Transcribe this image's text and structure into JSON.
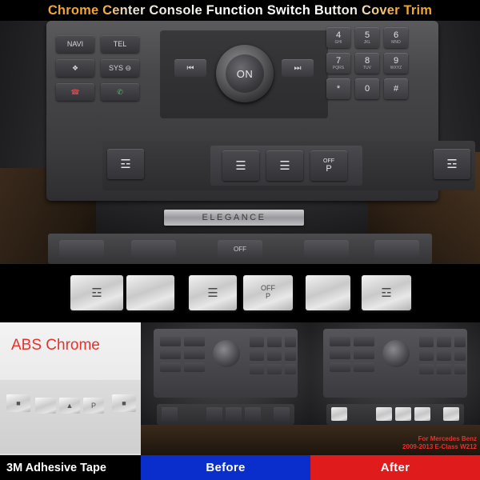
{
  "title": {
    "text": "Chrome Center Console Function Switch Button Cover Trim"
  },
  "main_photo": {
    "name": "mercedes-center-console-photo",
    "head_unit": {
      "knob_label": "ON",
      "prev_label": "⏮",
      "next_label": "⏭"
    },
    "left_keys": [
      {
        "label": "NAVI"
      },
      {
        "label": "TEL"
      },
      {
        "label": "❖"
      },
      {
        "label": "SYS ⊖"
      },
      {
        "label": "☎"
      },
      {
        "label": "✆"
      }
    ],
    "numpad": [
      {
        "n": "4",
        "s": "GHI"
      },
      {
        "n": "5",
        "s": "JKL"
      },
      {
        "n": "6",
        "s": "MNO"
      },
      {
        "n": "7",
        "s": "PQRS"
      },
      {
        "n": "8",
        "s": "TUV"
      },
      {
        "n": "9",
        "s": "WXYZ"
      },
      {
        "n": "*",
        "s": ""
      },
      {
        "n": "0",
        "s": ""
      },
      {
        "n": "#",
        "s": ""
      }
    ],
    "lower_row": {
      "seat_heat_left": "☲",
      "seat_left": "☰",
      "seat_right": "☰",
      "park_off": "OFF",
      "park_label": "P",
      "seat_heat_right": "☲"
    },
    "trim_badge": "ELEGANCE",
    "bottom_strip_buttons": [
      {
        "label": ""
      },
      {
        "label": ""
      },
      {
        "label": "OFF"
      },
      {
        "label": ""
      },
      {
        "label": ""
      }
    ]
  },
  "product_strip": {
    "name": "chrome-button-covers",
    "chips": [
      {
        "glyph": "☲",
        "kind": "seat-heat-left"
      },
      {
        "glyph": "",
        "kind": "blank-left"
      },
      {
        "glyph": "☰",
        "kind": "seat-left"
      },
      {
        "glyph": "OFF\nP",
        "kind": "park-brake"
      },
      {
        "glyph": "",
        "kind": "blank-right"
      },
      {
        "glyph": "☲",
        "kind": "seat-heat-right"
      }
    ]
  },
  "abs_panel": {
    "title": "ABS Chrome",
    "tape_label": "3M Adhesive Tape"
  },
  "before_panel": {
    "label": "Before"
  },
  "after_panel": {
    "label": "After",
    "fit_note_line1": "For Mercedes Benz",
    "fit_note_line2": "2009-2013  E-Class W212"
  }
}
